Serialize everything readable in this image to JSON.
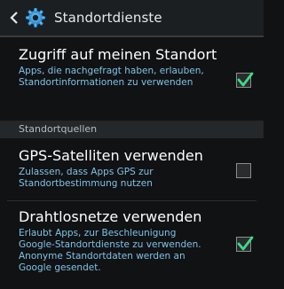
{
  "header": {
    "title": "Standortdienste",
    "back_icon": "chevron-left-icon",
    "app_icon": "gear-icon"
  },
  "settings": [
    {
      "title": "Zugriff auf meinen Standort",
      "description": "Apps, die nachgefragt haben, erlauben, Standortinformationen zu verwenden",
      "checked": true
    },
    {
      "title": "GPS-Satelliten verwenden",
      "description": "Zulassen, dass Apps GPS zur Standortbestimmung nutzen",
      "checked": false
    },
    {
      "title": "Drahtlosnetze verwenden",
      "description": "Erlaubt Apps, zur Beschleunigung Google-Standortdienste zu verwenden. Anonyme Standortdaten werden an Google gesendet.",
      "checked": true
    }
  ],
  "section_header": "Standortquellen",
  "colors": {
    "accent_check": "#3ddc84",
    "description_text": "#7ec3e8",
    "background": "#111214"
  }
}
